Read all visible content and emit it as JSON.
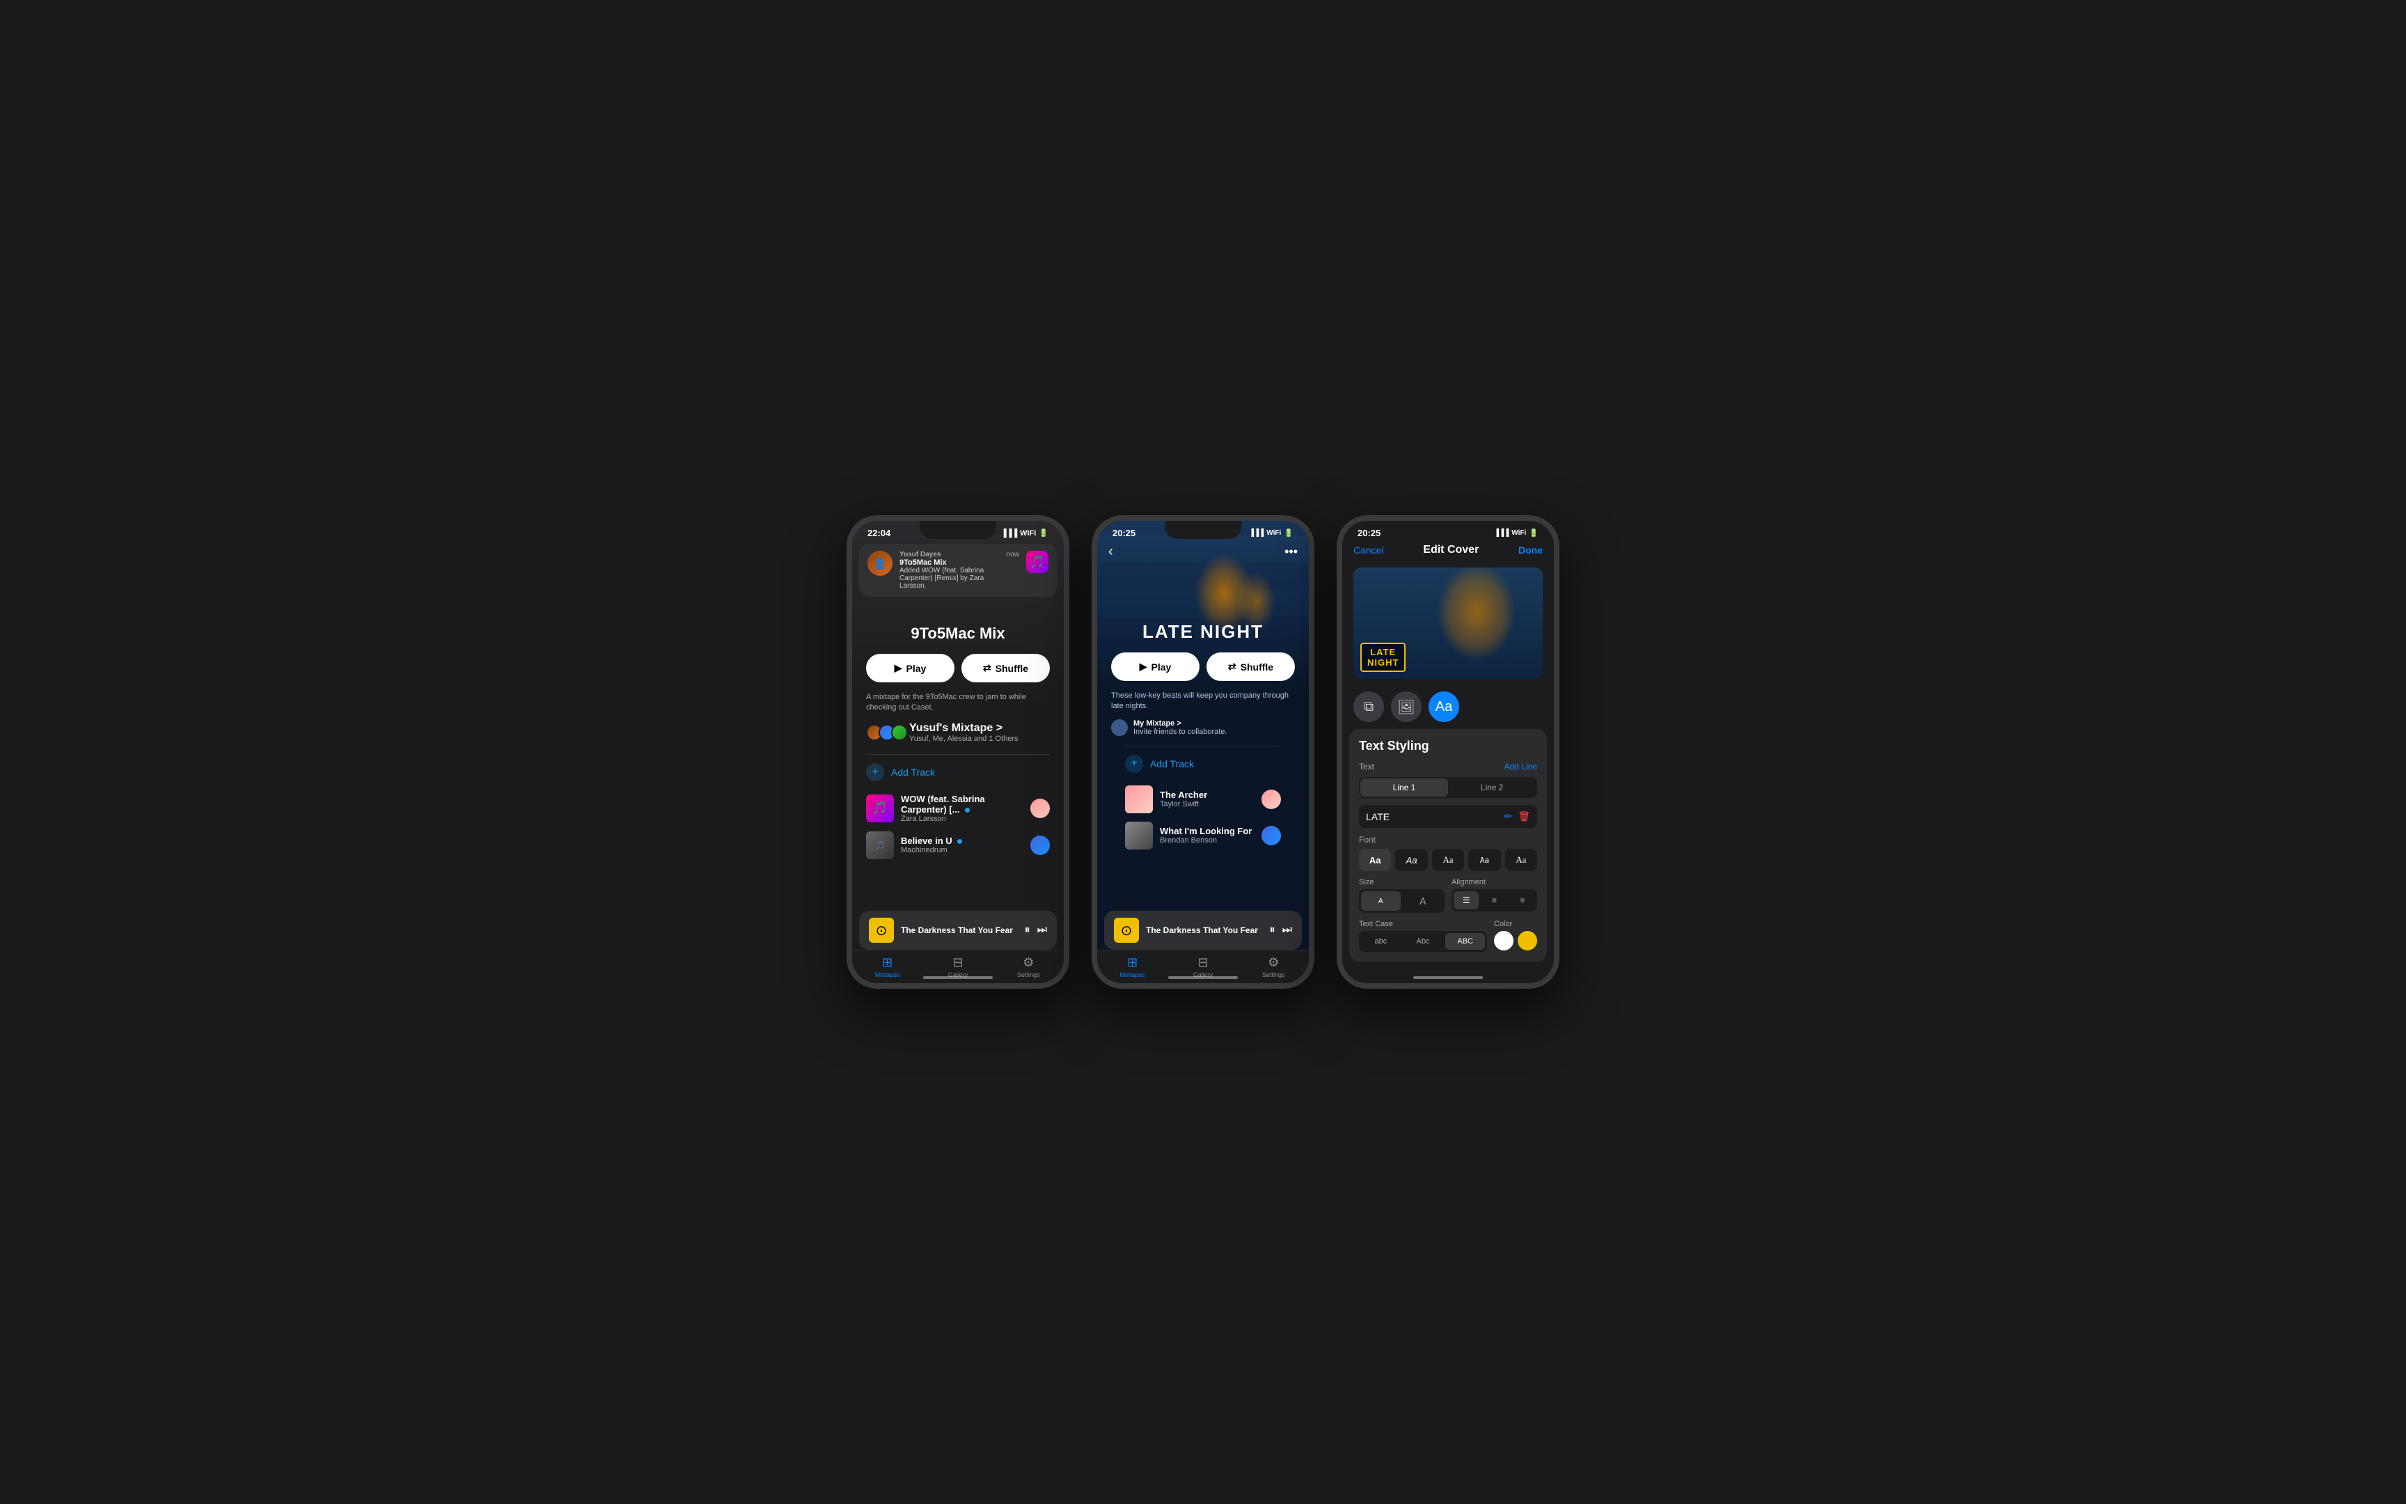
{
  "phone1": {
    "status_time": "22:04",
    "notification": {
      "app_name": "Yusuf Dayes",
      "playlist": "9To5Mac Mix",
      "body": "Added WOW (feat. Sabrina Carpenter) [Remix] by Zara Larsson.",
      "time": "now"
    },
    "playlist_title": "9To5Mac Mix",
    "play_button": "Play",
    "shuffle_button": "Shuffle",
    "description": "A mixtape for the 9To5Mac crew to jam to while checking out Caset.",
    "collaborators_name": "Yusuf's Mixtape >",
    "collaborators_sub": "Yusuf, Me, Alessia and 1 Others",
    "add_track": "Add Track",
    "tracks": [
      {
        "name": "WOW (feat. Sabrina Carpenter) [...",
        "artist": "Zara Larsson",
        "has_dot": true
      },
      {
        "name": "Believe in U",
        "artist": "Machinedrum",
        "has_dot": true
      },
      {
        "name": "The Darkness That You Fear",
        "artist": "",
        "has_dot": false
      }
    ],
    "mini_player": {
      "title": "The Darkness That You Fear"
    },
    "tabs": [
      "Mixtapes",
      "Gallery",
      "Settings"
    ]
  },
  "phone2": {
    "status_time": "20:25",
    "playlist_title": "LATE NIGHT",
    "play_button": "Play",
    "shuffle_button": "Shuffle",
    "description": "These low-key beats will keep you company through late nights.",
    "collaborators_name": "My Mixtape >",
    "collaborators_sub": "Invite friends to collaborate.",
    "add_track": "Add Track",
    "tracks": [
      {
        "name": "The Archer",
        "artist": "Taylor Swift"
      },
      {
        "name": "What I'm Looking For",
        "artist": "Brendan Benson"
      },
      {
        "name": "The Darkness That You Fear",
        "artist": ""
      }
    ],
    "tabs": [
      "Mixtapes",
      "Gallery",
      "Settings"
    ]
  },
  "phone3": {
    "status_time": "20:25",
    "nav": {
      "cancel": "Cancel",
      "title": "Edit Cover",
      "done": "Done"
    },
    "cover": {
      "line1": "LATE",
      "line2": "NIGHT"
    },
    "tools": [
      "layers-icon",
      "image-icon",
      "text-icon"
    ],
    "text_styling": {
      "title": "Text Styling",
      "text_label": "Text",
      "add_line": "Add Line",
      "line1_tab": "Line 1",
      "line2_tab": "Line 2",
      "text_value": "LATE",
      "font_label": "Font",
      "fonts": [
        "Aa",
        "Aa",
        "Aa",
        "Aa",
        "Aa"
      ],
      "size_label": "Size",
      "size_options": [
        "A",
        "A"
      ],
      "alignment_label": "Alignment",
      "align_options": [
        "≡",
        "≡",
        "≡"
      ],
      "text_case_label": "Text Case",
      "case_options": [
        "abc",
        "Abc",
        "ABC"
      ],
      "color_label": "Color",
      "colors": [
        "#ffffff",
        "#f0c000"
      ]
    }
  }
}
